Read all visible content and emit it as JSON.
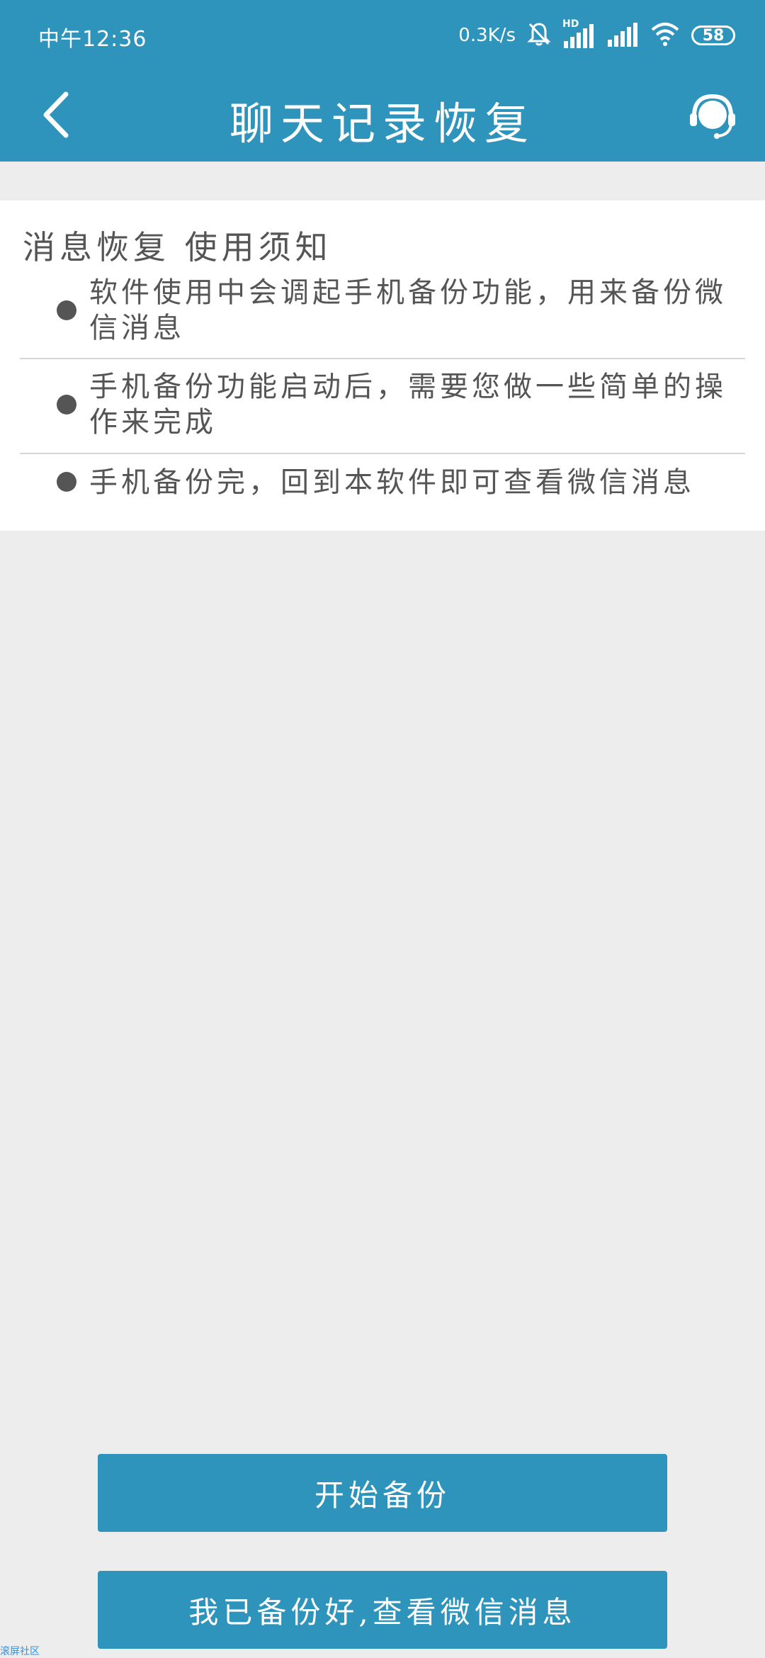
{
  "status_bar": {
    "time": "中午12:36",
    "net_speed": "0.3K/s",
    "battery": "58",
    "hd_label": "HD"
  },
  "header": {
    "title": "聊天记录恢复"
  },
  "notice": {
    "title": "消息恢复 使用须知",
    "items": [
      {
        "text": "软件使用中会调起手机备份功能，用来备份微信消息"
      },
      {
        "text": "手机备份功能启动后，需要您做一些简单的操作来完成"
      },
      {
        "text": "手机备份完，回到本软件即可查看微信消息"
      }
    ]
  },
  "buttons": {
    "start_backup": "开始备份",
    "view_messages": "我已备份好,查看微信消息"
  },
  "watermark": "滚屏社区",
  "colors": {
    "accent": "#2f94bc",
    "background": "#ededed",
    "text": "#555555"
  }
}
